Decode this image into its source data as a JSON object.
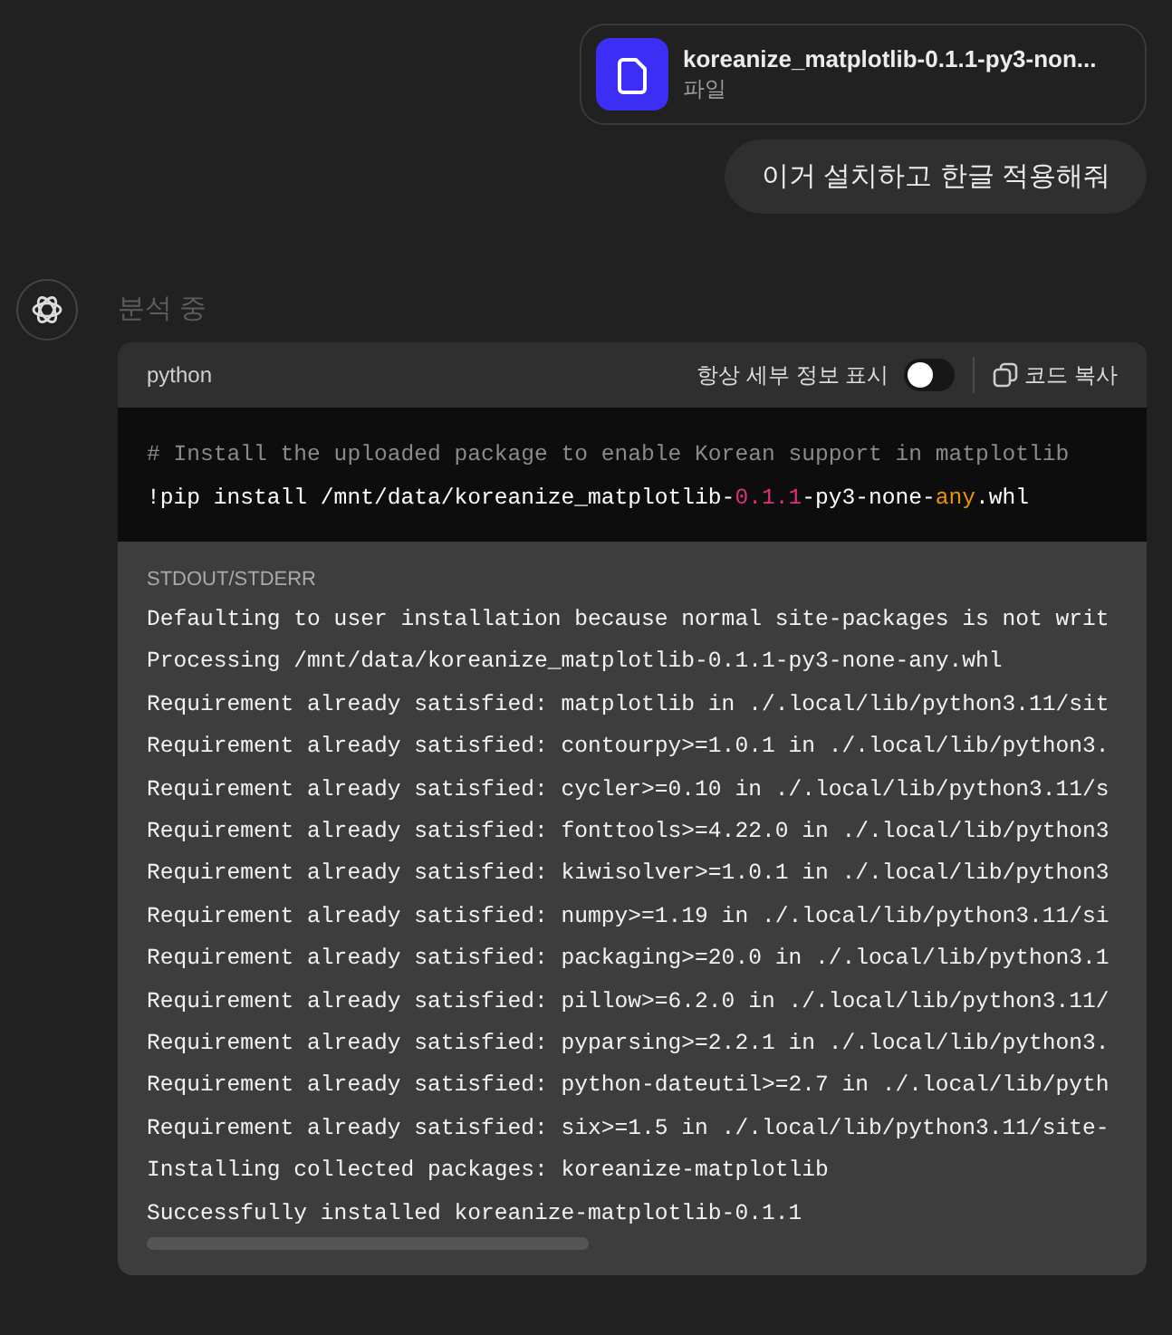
{
  "attachment": {
    "name": "koreanize_matplotlib-0.1.1-py3-non...",
    "type_label": "파일"
  },
  "user_message": "이거 설치하고 한글 적용해줘",
  "assistant": {
    "status": "분석 중"
  },
  "code_block": {
    "language": "python",
    "details_toggle": {
      "label": "항상 세부 정보 표시",
      "on": false
    },
    "copy_button": "코드 복사",
    "code_lines": [
      [
        {
          "kind": "comment",
          "text": "# Install the uploaded package to enable Korean support in matplotlib"
        }
      ],
      [
        {
          "kind": "plain",
          "text": "!pip install /mnt/data/koreanize_matplotlib-"
        },
        {
          "kind": "number",
          "text": "0.1.1"
        },
        {
          "kind": "plain",
          "text": "-py3-none-"
        },
        {
          "kind": "keyword",
          "text": "any"
        },
        {
          "kind": "plain",
          "text": ".whl"
        }
      ]
    ],
    "output_label": "STDOUT/STDERR",
    "output_lines": [
      "Defaulting to user installation because normal site-packages is not writ",
      "Processing /mnt/data/koreanize_matplotlib-0.1.1-py3-none-any.whl",
      "Requirement already satisfied: matplotlib in ./.local/lib/python3.11/sit",
      "Requirement already satisfied: contourpy>=1.0.1 in ./.local/lib/python3.",
      "Requirement already satisfied: cycler>=0.10 in ./.local/lib/python3.11/s",
      "Requirement already satisfied: fonttools>=4.22.0 in ./.local/lib/python3",
      "Requirement already satisfied: kiwisolver>=1.0.1 in ./.local/lib/python3",
      "Requirement already satisfied: numpy>=1.19 in ./.local/lib/python3.11/si",
      "Requirement already satisfied: packaging>=20.0 in ./.local/lib/python3.1",
      "Requirement already satisfied: pillow>=6.2.0 in ./.local/lib/python3.11/",
      "Requirement already satisfied: pyparsing>=2.2.1 in ./.local/lib/python3.",
      "Requirement already satisfied: python-dateutil>=2.7 in ./.local/lib/pyth",
      "Requirement already satisfied: six>=1.5 in ./.local/lib/python3.11/site-",
      "Installing collected packages: koreanize-matplotlib",
      "Successfully installed koreanize-matplotlib-0.1.1"
    ]
  }
}
